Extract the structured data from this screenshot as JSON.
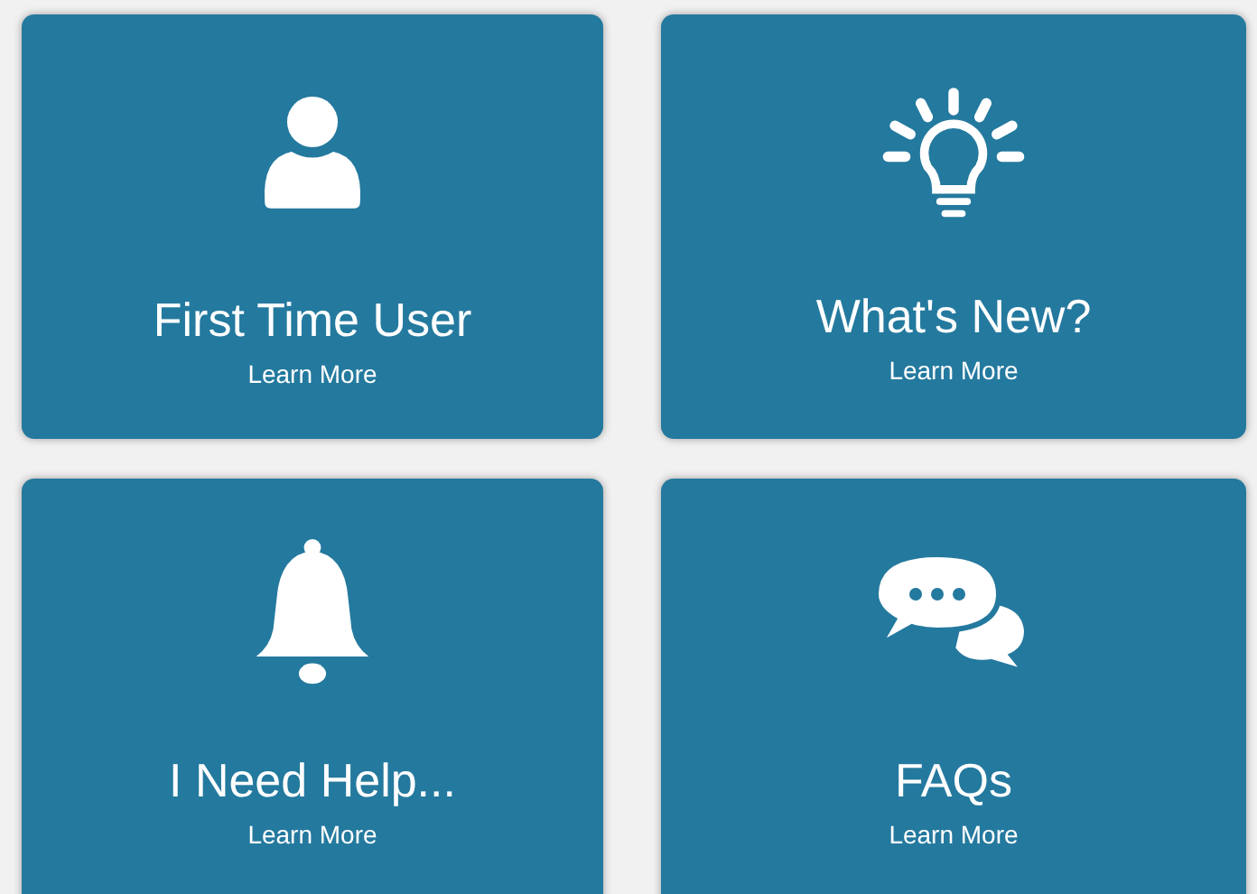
{
  "cards": [
    {
      "title": "First Time User",
      "link": "Learn More"
    },
    {
      "title": "What's New?",
      "link": "Learn More"
    },
    {
      "title": "I Need Help...",
      "link": "Learn More"
    },
    {
      "title": "FAQs",
      "link": "Learn More"
    }
  ]
}
